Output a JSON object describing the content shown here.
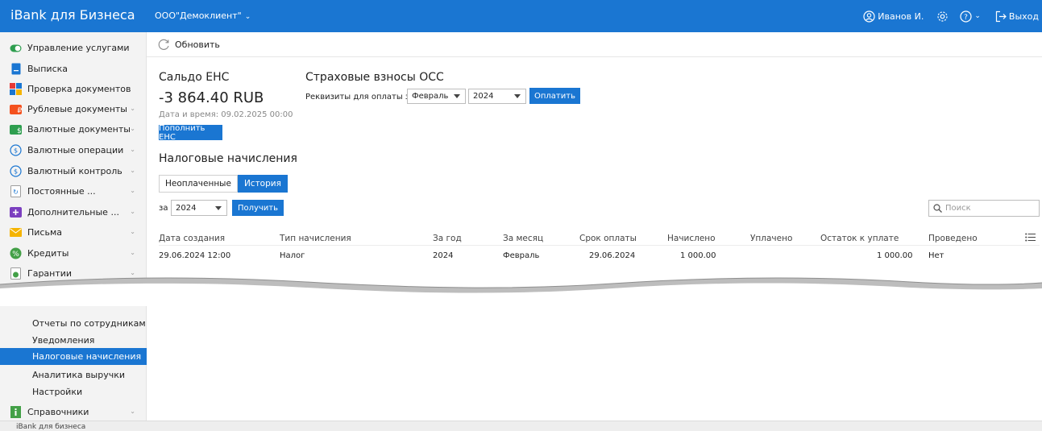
{
  "header": {
    "brand": "iBank для Бизнеса",
    "org": "ООО\"Демоклиент\"",
    "user": "Иванов И.",
    "logout": "Выход"
  },
  "sidebar": {
    "items": [
      {
        "label": "Управление услугами",
        "icon": "toggle-icon",
        "color": "#2e9e4f"
      },
      {
        "label": "Выписка",
        "icon": "document-icon",
        "color": "#1a76d2"
      },
      {
        "label": "Проверка документов",
        "icon": "grid-check-icon",
        "color": "#e53935"
      },
      {
        "label": "Рублевые документы",
        "icon": "ruble-icon",
        "color": "#f4511e"
      },
      {
        "label": "Валютные документы",
        "icon": "currency-doc-icon",
        "color": "#2e9e4f"
      },
      {
        "label": "Валютные операции",
        "icon": "currency-exchange-icon",
        "color": "#1a76d2"
      },
      {
        "label": "Валютный контроль",
        "icon": "currency-control-icon",
        "color": "#1a76d2"
      },
      {
        "label": "Постоянные ...",
        "icon": "recurring-icon",
        "color": "#1a76d2"
      },
      {
        "label": "Дополнительные ...",
        "icon": "plus-icon",
        "color": "#7b3fbf"
      },
      {
        "label": "Письма",
        "icon": "envelope-icon",
        "color": "#f5b400"
      },
      {
        "label": "Кредиты",
        "icon": "credit-icon",
        "color": "#43a047"
      },
      {
        "label": "Гарантии",
        "icon": "guarantee-icon",
        "color": "#43a047"
      }
    ],
    "subitems": [
      {
        "label": "Отчеты по сотрудникам",
        "active": false
      },
      {
        "label": "Уведомления",
        "active": false
      },
      {
        "label": "Налоговые начисления",
        "active": true
      },
      {
        "label": "Аналитика выручки",
        "active": false
      },
      {
        "label": "Настройки",
        "active": false
      }
    ],
    "directories": "Справочники"
  },
  "toolbar": {
    "refresh": "Обновить"
  },
  "ens": {
    "title": "Сальдо ЕНС",
    "amount": "-3 864.40 RUB",
    "datetime": "Дата и время: 09.02.2025 00:00",
    "topup": "Пополнить ЕНС"
  },
  "oss": {
    "title": "Страховые взносы ОСС",
    "label": "Реквизиты для оплаты за",
    "month": "Февраль",
    "year": "2024",
    "pay": "Оплатить"
  },
  "taxes": {
    "title": "Налоговые начисления",
    "tabs": [
      "Неоплаченные",
      "История"
    ],
    "active_tab": "История",
    "period_label": "за",
    "year": "2024",
    "get": "Получить",
    "search_placeholder": "Поиск"
  },
  "table": {
    "columns": [
      "Дата создания",
      "Тип начисления",
      "За год",
      "За месяц",
      "Срок оплаты",
      "Начислено",
      "Уплачено",
      "Остаток к уплате",
      "Проведено"
    ],
    "rows": [
      [
        "29.06.2024 12:00",
        "Налог",
        "2024",
        "Февраль",
        "29.06.2024",
        "1 000.00",
        "",
        "1 000.00",
        "Нет"
      ]
    ]
  },
  "footer": {
    "text": "iBank для бизнеса"
  }
}
